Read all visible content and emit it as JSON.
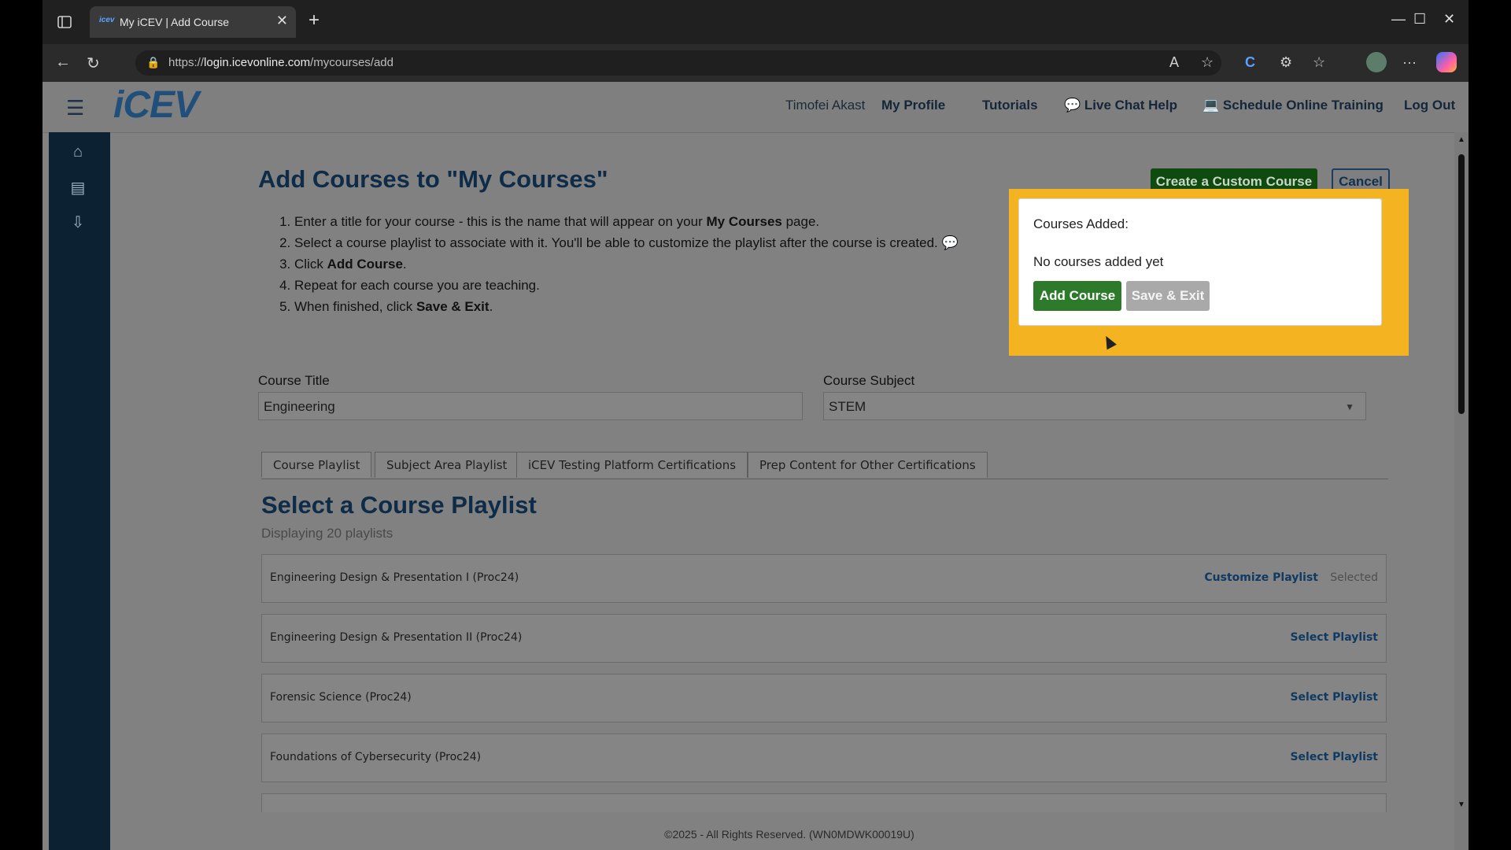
{
  "browser": {
    "tab_title": "My iCEV | Add Course",
    "favicon_text": "icev",
    "url_scheme": "https://",
    "url_host": "login.icevonline.com",
    "url_path": "/mycourses/add"
  },
  "header": {
    "logo": "iCEV",
    "user_name": "Timofei Akast",
    "nav": [
      "My Profile",
      "Tutorials",
      "Live Chat Help",
      "Schedule Online Training",
      "Log Out"
    ]
  },
  "page": {
    "title": "Add Courses to \"My Courses\"",
    "create_button": "Create a Custom Course",
    "cancel_button": "Cancel",
    "steps": {
      "s1a": "Enter a title for your course - this is the name that will appear on your ",
      "s1b": "My Courses",
      "s1c": " page.",
      "s2": "Select a course playlist to associate with it. You'll be able to customize the playlist after the course is created.",
      "s3a": "Click ",
      "s3b": "Add Course",
      "s3c": ".",
      "s4": "Repeat for each course you are teaching.",
      "s5a": "When finished, click ",
      "s5b": "Save & Exit",
      "s5c": "."
    },
    "course_title_label": "Course Title",
    "course_title_value": "Engineering",
    "course_subject_label": "Course Subject",
    "course_subject_value": "STEM",
    "tabs": [
      "Course Playlist",
      "Subject Area Playlist",
      "iCEV Testing Platform Certifications",
      "Prep Content for Other Certifications"
    ],
    "section_title": "Select a Course Playlist",
    "section_subtitle": "Displaying 20 playlists",
    "playlists": [
      {
        "name": "Engineering Design & Presentation I (Proc24)",
        "customize": "Customize Playlist",
        "action": "Selected"
      },
      {
        "name": "Engineering Design & Presentation II (Proc24)",
        "action": "Select Playlist"
      },
      {
        "name": "Forensic Science (Proc24)",
        "action": "Select Playlist"
      },
      {
        "name": "Foundations of Cybersecurity (Proc24)",
        "action": "Select Playlist"
      }
    ],
    "footer": "©2025 - All Rights Reserved. (WN0MDWK00019U)"
  },
  "panel": {
    "title": "Courses Added:",
    "empty": "No courses added yet",
    "add_button": "Add Course",
    "save_button": "Save & Exit"
  },
  "colors": {
    "highlight": "#f4b321",
    "primary_green": "#2d7a2a",
    "navy": "#0e2c48"
  }
}
